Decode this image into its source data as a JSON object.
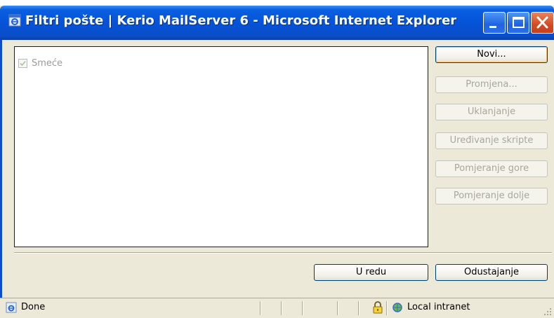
{
  "window": {
    "title": "Filtri pošte | Kerio MailServer 6 - Microsoft Internet Explorer"
  },
  "filters": {
    "items": [
      {
        "label": "Smeće",
        "checked": true
      }
    ]
  },
  "side_buttons": {
    "new": "Novi...",
    "edit": "Promjena...",
    "remove": "Uklanjanje",
    "edit_script": "Uređivanje skripte",
    "move_up": "Pomjeranje gore",
    "move_down": "Pomjeranje dolje"
  },
  "footer_buttons": {
    "ok": "U redu",
    "cancel": "Odustajanje"
  },
  "status": {
    "text": "Done",
    "zone": "Local intranet"
  },
  "colors": {
    "titlebar": "#0553d8",
    "window_bg": "#ece9d8",
    "close_button": "#d34a23"
  }
}
